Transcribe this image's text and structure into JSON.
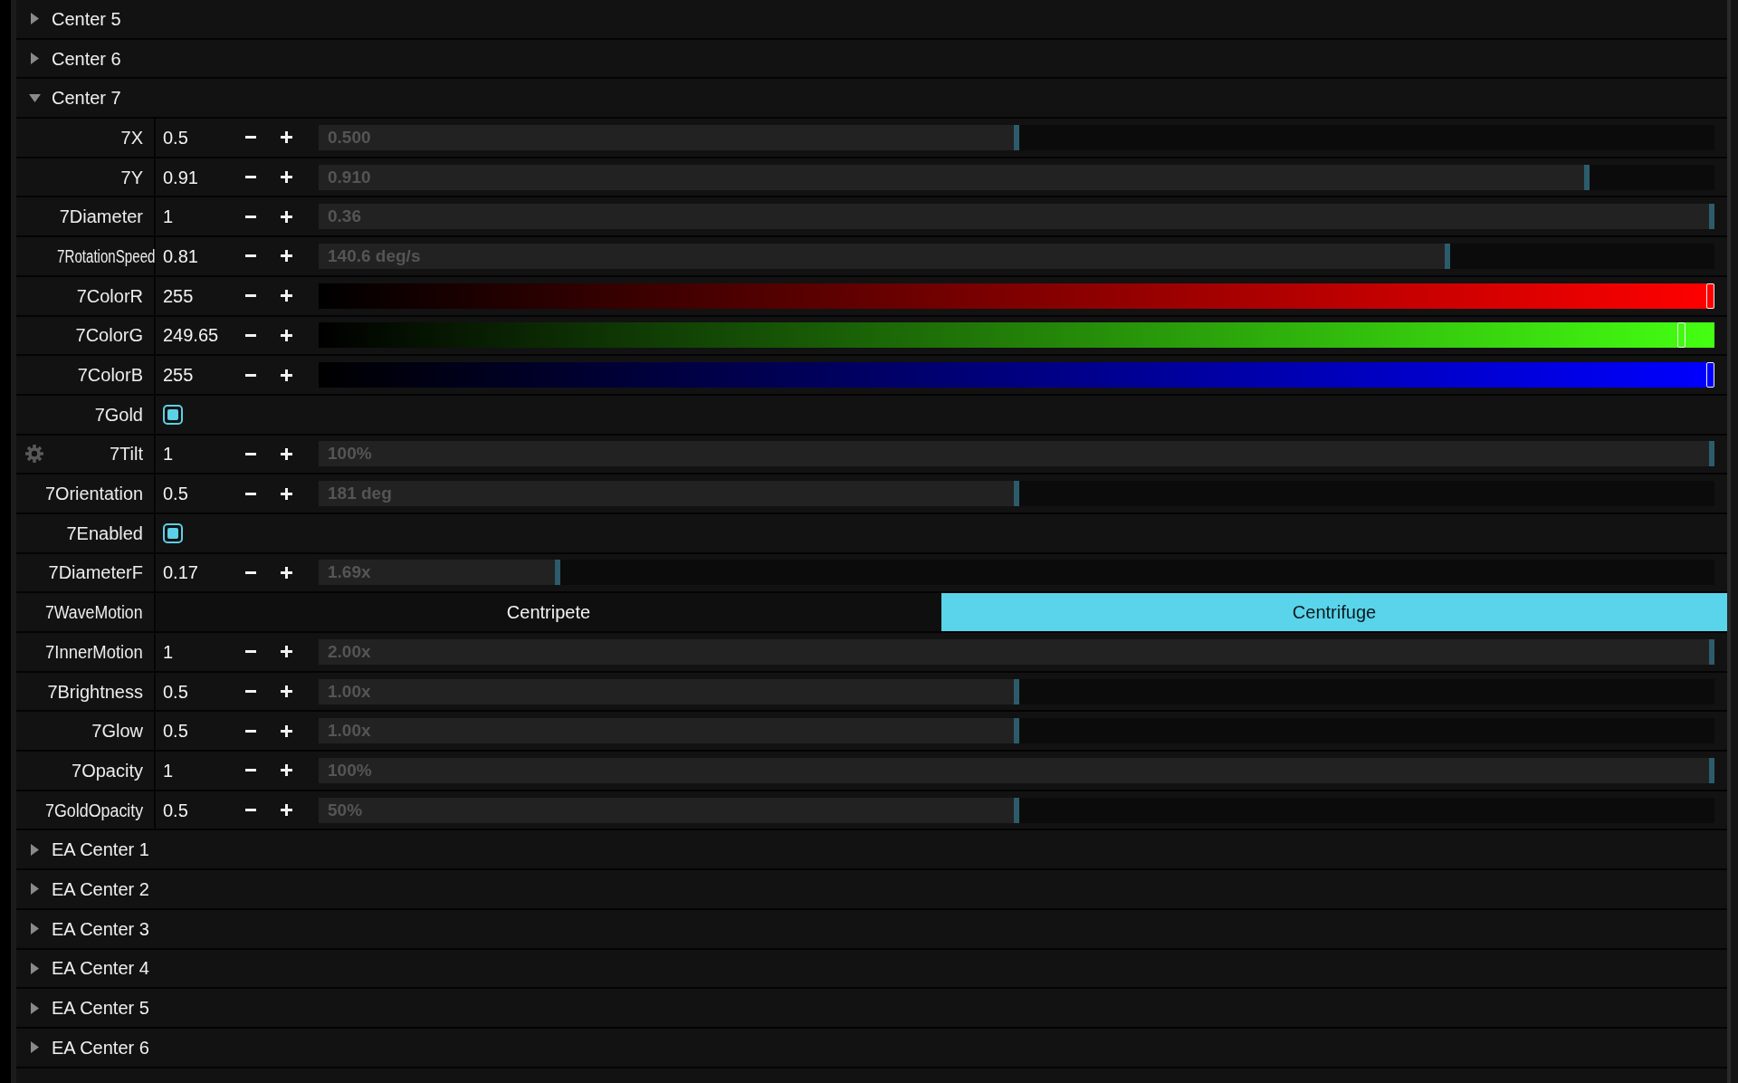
{
  "groups": [
    {
      "title": "Center 5",
      "expanded": false
    },
    {
      "title": "Center 6",
      "expanded": false
    },
    {
      "title": "Center 7",
      "expanded": true,
      "params": [
        {
          "kind": "slider",
          "label": "7X",
          "value": "0.5",
          "display": "0.500",
          "level": 0.5,
          "settings_icon": false
        },
        {
          "kind": "slider",
          "label": "7Y",
          "value": "0.91",
          "display": "0.910",
          "level": 0.91,
          "settings_icon": false
        },
        {
          "kind": "slider",
          "label": "7Diameter",
          "value": "1",
          "display": "0.36",
          "level": 1,
          "settings_icon": false
        },
        {
          "kind": "slider",
          "label": "7RotationSpeed",
          "value": "0.81",
          "display": "140.6 deg/s",
          "level": 0.81,
          "settings_icon": false
        },
        {
          "kind": "color",
          "label": "7ColorR",
          "value": "255",
          "level": 1,
          "color": "#ff0000",
          "settings_icon": false
        },
        {
          "kind": "color",
          "label": "7ColorG",
          "value": "249.65",
          "level": 0.979,
          "color": "#44ff11",
          "settings_icon": false
        },
        {
          "kind": "color",
          "label": "7ColorB",
          "value": "255",
          "level": 1,
          "color": "#0000ff",
          "settings_icon": false
        },
        {
          "kind": "checkbox",
          "label": "7Gold",
          "checked": true,
          "settings_icon": false
        },
        {
          "kind": "slider",
          "label": "7Tilt",
          "value": "1",
          "display": "100%",
          "level": 1,
          "settings_icon": true
        },
        {
          "kind": "slider",
          "label": "7Orientation",
          "value": "0.5",
          "display": "181 deg",
          "level": 0.5,
          "settings_icon": false
        },
        {
          "kind": "checkbox",
          "label": "7Enabled",
          "checked": true,
          "settings_icon": false
        },
        {
          "kind": "slider",
          "label": "7DiameterF",
          "value": "0.17",
          "display": "1.69x",
          "level": 0.17,
          "settings_icon": false
        },
        {
          "kind": "choice",
          "label": "7WaveMotion",
          "options": [
            {
              "label": "Centripete",
              "selected": false
            },
            {
              "label": "Centrifuge",
              "selected": true
            }
          ],
          "settings_icon": false
        },
        {
          "kind": "slider",
          "label": "7InnerMotion",
          "value": "1",
          "display": "2.00x",
          "level": 1,
          "settings_icon": false
        },
        {
          "kind": "slider",
          "label": "7Brightness",
          "value": "0.5",
          "display": "1.00x",
          "level": 0.5,
          "settings_icon": false
        },
        {
          "kind": "slider",
          "label": "7Glow",
          "value": "0.5",
          "display": "1.00x",
          "level": 0.5,
          "settings_icon": false
        },
        {
          "kind": "slider",
          "label": "7Opacity",
          "value": "1",
          "display": "100%",
          "level": 1,
          "settings_icon": false
        },
        {
          "kind": "slider",
          "label": "7GoldOpacity",
          "value": "0.5",
          "display": "50%",
          "level": 0.5,
          "settings_icon": false
        }
      ]
    },
    {
      "title": "EA Center 1",
      "expanded": false
    },
    {
      "title": "EA Center 2",
      "expanded": false
    },
    {
      "title": "EA Center 3",
      "expanded": false
    },
    {
      "title": "EA Center 4",
      "expanded": false
    },
    {
      "title": "EA Center 5",
      "expanded": false
    },
    {
      "title": "EA Center 6",
      "expanded": false
    }
  ]
}
